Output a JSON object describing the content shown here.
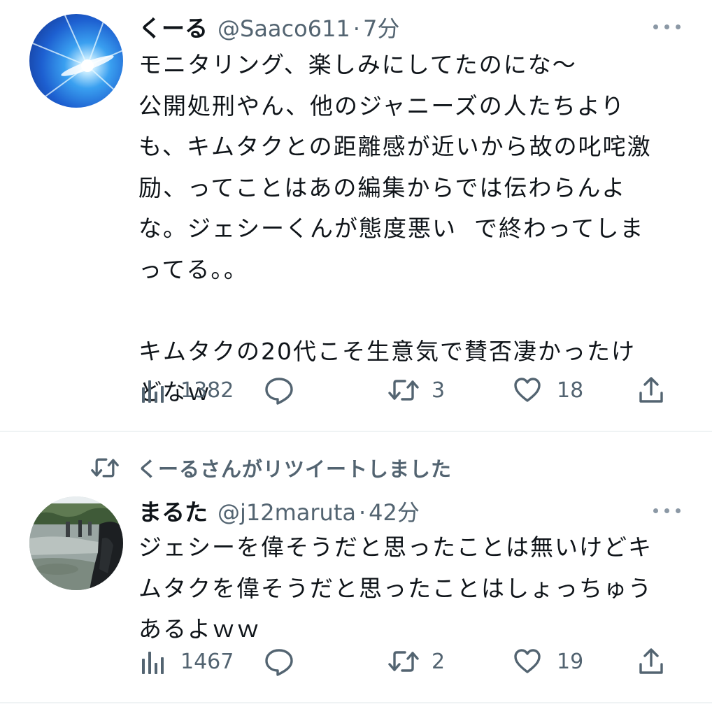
{
  "tweets": [
    {
      "display_name": "くーる",
      "handle": "@Saaco611",
      "separator": "·",
      "time": "7分",
      "text": "モニタリング、楽しみにしてたのにな～\n公開処刑やん、他のジャニーズの人たちより\nも、キムタクとの距離感が近いから故の叱咤激\n励、ってことはあの編集からでは伝わらんよ\nな。ジェシーくんが態度悪い  で終わってしま\nってる。。\n\nキムタクの20代こそ生意気で賛否凄かったけ\nどなｗ",
      "views": "1382",
      "replies": "",
      "retweets": "3",
      "likes": "18",
      "avatar_icon": "blue-light-burst-avatar"
    },
    {
      "retweet_banner": "くーるさんがリツイートしました",
      "display_name": "まるた",
      "handle": "@j12maruta",
      "separator": "·",
      "time": "42分",
      "text": "ジェシーを偉そうだと思ったことは無いけどキ\nムタクを偉そうだと思ったことはしょっちゅう\nあるよｗｗ",
      "views": "1467",
      "replies": "",
      "retweets": "2",
      "likes": "19",
      "avatar_icon": "river-photo-avatar"
    }
  ],
  "colors": {
    "text_primary": "#0f1419",
    "text_secondary": "#536471",
    "divider": "#eff3f4"
  }
}
